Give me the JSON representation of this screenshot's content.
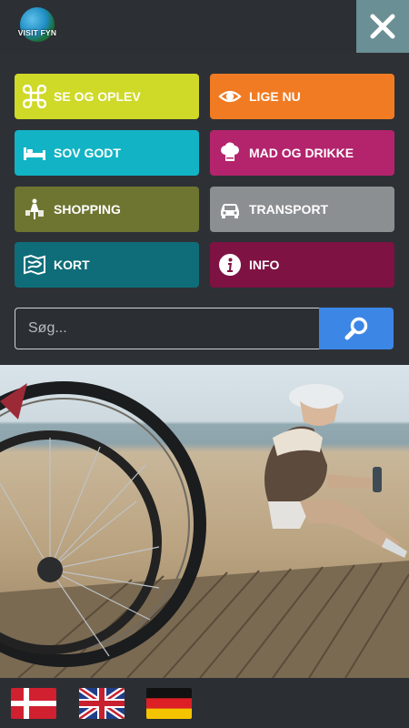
{
  "header": {
    "logo_text": "VISIT FYN"
  },
  "menu": {
    "items": [
      {
        "label": "SE OG OPLEV",
        "color": "#cfd928"
      },
      {
        "label": "LIGE NU",
        "color": "#f07b22"
      },
      {
        "label": "SOV GODT",
        "color": "#12b3c5"
      },
      {
        "label": "MAD OG DRIKKE",
        "color": "#b3246c"
      },
      {
        "label": "SHOPPING",
        "color": "#6e7530"
      },
      {
        "label": "TRANSPORT",
        "color": "#8c8f92"
      },
      {
        "label": "KORT",
        "color": "#0f6d79"
      },
      {
        "label": "INFO",
        "color": "#7e1243"
      }
    ]
  },
  "search": {
    "placeholder": "Søg...",
    "button_color": "#3c86e6"
  },
  "languages": [
    {
      "icon": "danish-flag-icon"
    },
    {
      "icon": "uk-flag-icon"
    },
    {
      "icon": "german-flag-icon"
    }
  ]
}
